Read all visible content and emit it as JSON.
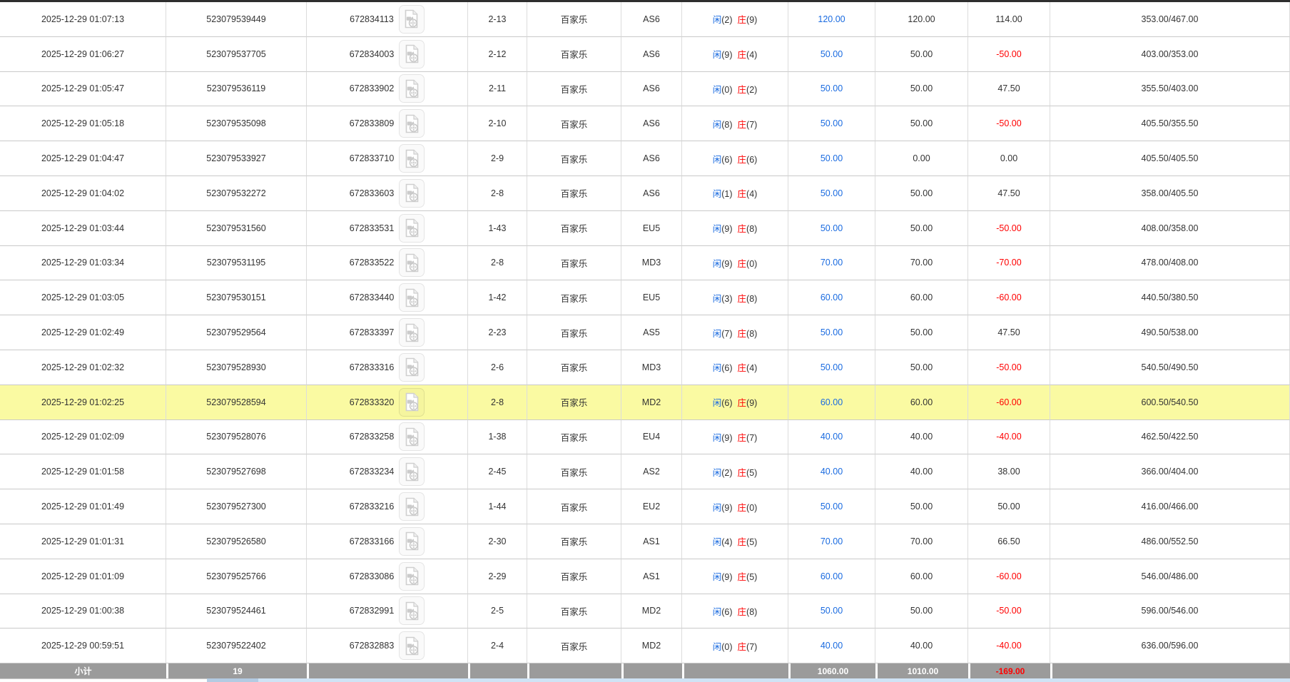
{
  "colors": {
    "accent_blue": "#1a6be0",
    "accent_red": "#ff0000",
    "highlight_yellow": "#fafaa2",
    "footer_grey": "#9b9b9b"
  },
  "labels": {
    "player": "闲",
    "banker": "庄"
  },
  "icons": {
    "replay": "video-replay-icon"
  },
  "rows": [
    {
      "time": "2025-12-29 01:07:13",
      "bet_no": "523079539449",
      "round_no": "672834113",
      "shoe_round": "2-13",
      "game": "百家乐",
      "table_code": "AS6",
      "player_score": "2",
      "banker_score": "9",
      "bet_amount": "120.00",
      "valid_amount": "120.00",
      "win_loss": "114.00",
      "balance": "353.00/467.00",
      "highlighted": false
    },
    {
      "time": "2025-12-29 01:06:27",
      "bet_no": "523079537705",
      "round_no": "672834003",
      "shoe_round": "2-12",
      "game": "百家乐",
      "table_code": "AS6",
      "player_score": "9",
      "banker_score": "4",
      "bet_amount": "50.00",
      "valid_amount": "50.00",
      "win_loss": "-50.00",
      "balance": "403.00/353.00",
      "highlighted": false
    },
    {
      "time": "2025-12-29 01:05:47",
      "bet_no": "523079536119",
      "round_no": "672833902",
      "shoe_round": "2-11",
      "game": "百家乐",
      "table_code": "AS6",
      "player_score": "0",
      "banker_score": "2",
      "bet_amount": "50.00",
      "valid_amount": "50.00",
      "win_loss": "47.50",
      "balance": "355.50/403.00",
      "highlighted": false
    },
    {
      "time": "2025-12-29 01:05:18",
      "bet_no": "523079535098",
      "round_no": "672833809",
      "shoe_round": "2-10",
      "game": "百家乐",
      "table_code": "AS6",
      "player_score": "8",
      "banker_score": "7",
      "bet_amount": "50.00",
      "valid_amount": "50.00",
      "win_loss": "-50.00",
      "balance": "405.50/355.50",
      "highlighted": false
    },
    {
      "time": "2025-12-29 01:04:47",
      "bet_no": "523079533927",
      "round_no": "672833710",
      "shoe_round": "2-9",
      "game": "百家乐",
      "table_code": "AS6",
      "player_score": "6",
      "banker_score": "6",
      "bet_amount": "50.00",
      "valid_amount": "0.00",
      "win_loss": "0.00",
      "balance": "405.50/405.50",
      "highlighted": false
    },
    {
      "time": "2025-12-29 01:04:02",
      "bet_no": "523079532272",
      "round_no": "672833603",
      "shoe_round": "2-8",
      "game": "百家乐",
      "table_code": "AS6",
      "player_score": "1",
      "banker_score": "4",
      "bet_amount": "50.00",
      "valid_amount": "50.00",
      "win_loss": "47.50",
      "balance": "358.00/405.50",
      "highlighted": false
    },
    {
      "time": "2025-12-29 01:03:44",
      "bet_no": "523079531560",
      "round_no": "672833531",
      "shoe_round": "1-43",
      "game": "百家乐",
      "table_code": "EU5",
      "player_score": "9",
      "banker_score": "8",
      "bet_amount": "50.00",
      "valid_amount": "50.00",
      "win_loss": "-50.00",
      "balance": "408.00/358.00",
      "highlighted": false
    },
    {
      "time": "2025-12-29 01:03:34",
      "bet_no": "523079531195",
      "round_no": "672833522",
      "shoe_round": "2-8",
      "game": "百家乐",
      "table_code": "MD3",
      "player_score": "9",
      "banker_score": "0",
      "bet_amount": "70.00",
      "valid_amount": "70.00",
      "win_loss": "-70.00",
      "balance": "478.00/408.00",
      "highlighted": false
    },
    {
      "time": "2025-12-29 01:03:05",
      "bet_no": "523079530151",
      "round_no": "672833440",
      "shoe_round": "1-42",
      "game": "百家乐",
      "table_code": "EU5",
      "player_score": "3",
      "banker_score": "8",
      "bet_amount": "60.00",
      "valid_amount": "60.00",
      "win_loss": "-60.00",
      "balance": "440.50/380.50",
      "highlighted": false
    },
    {
      "time": "2025-12-29 01:02:49",
      "bet_no": "523079529564",
      "round_no": "672833397",
      "shoe_round": "2-23",
      "game": "百家乐",
      "table_code": "AS5",
      "player_score": "7",
      "banker_score": "8",
      "bet_amount": "50.00",
      "valid_amount": "50.00",
      "win_loss": "47.50",
      "balance": "490.50/538.00",
      "highlighted": false
    },
    {
      "time": "2025-12-29 01:02:32",
      "bet_no": "523079528930",
      "round_no": "672833316",
      "shoe_round": "2-6",
      "game": "百家乐",
      "table_code": "MD3",
      "player_score": "6",
      "banker_score": "4",
      "bet_amount": "50.00",
      "valid_amount": "50.00",
      "win_loss": "-50.00",
      "balance": "540.50/490.50",
      "highlighted": false
    },
    {
      "time": "2025-12-29 01:02:25",
      "bet_no": "523079528594",
      "round_no": "672833320",
      "shoe_round": "2-8",
      "game": "百家乐",
      "table_code": "MD2",
      "player_score": "6",
      "banker_score": "9",
      "bet_amount": "60.00",
      "valid_amount": "60.00",
      "win_loss": "-60.00",
      "balance": "600.50/540.50",
      "highlighted": true
    },
    {
      "time": "2025-12-29 01:02:09",
      "bet_no": "523079528076",
      "round_no": "672833258",
      "shoe_round": "1-38",
      "game": "百家乐",
      "table_code": "EU4",
      "player_score": "9",
      "banker_score": "7",
      "bet_amount": "40.00",
      "valid_amount": "40.00",
      "win_loss": "-40.00",
      "balance": "462.50/422.50",
      "highlighted": false
    },
    {
      "time": "2025-12-29 01:01:58",
      "bet_no": "523079527698",
      "round_no": "672833234",
      "shoe_round": "2-45",
      "game": "百家乐",
      "table_code": "AS2",
      "player_score": "2",
      "banker_score": "5",
      "bet_amount": "40.00",
      "valid_amount": "40.00",
      "win_loss": "38.00",
      "balance": "366.00/404.00",
      "highlighted": false
    },
    {
      "time": "2025-12-29 01:01:49",
      "bet_no": "523079527300",
      "round_no": "672833216",
      "shoe_round": "1-44",
      "game": "百家乐",
      "table_code": "EU2",
      "player_score": "9",
      "banker_score": "0",
      "bet_amount": "50.00",
      "valid_amount": "50.00",
      "win_loss": "50.00",
      "balance": "416.00/466.00",
      "highlighted": false
    },
    {
      "time": "2025-12-29 01:01:31",
      "bet_no": "523079526580",
      "round_no": "672833166",
      "shoe_round": "2-30",
      "game": "百家乐",
      "table_code": "AS1",
      "player_score": "4",
      "banker_score": "5",
      "bet_amount": "70.00",
      "valid_amount": "70.00",
      "win_loss": "66.50",
      "balance": "486.00/552.50",
      "highlighted": false
    },
    {
      "time": "2025-12-29 01:01:09",
      "bet_no": "523079525766",
      "round_no": "672833086",
      "shoe_round": "2-29",
      "game": "百家乐",
      "table_code": "AS1",
      "player_score": "9",
      "banker_score": "5",
      "bet_amount": "60.00",
      "valid_amount": "60.00",
      "win_loss": "-60.00",
      "balance": "546.00/486.00",
      "highlighted": false
    },
    {
      "time": "2025-12-29 01:00:38",
      "bet_no": "523079524461",
      "round_no": "672832991",
      "shoe_round": "2-5",
      "game": "百家乐",
      "table_code": "MD2",
      "player_score": "6",
      "banker_score": "8",
      "bet_amount": "50.00",
      "valid_amount": "50.00",
      "win_loss": "-50.00",
      "balance": "596.00/546.00",
      "highlighted": false
    },
    {
      "time": "2025-12-29 00:59:51",
      "bet_no": "523079522402",
      "round_no": "672832883",
      "shoe_round": "2-4",
      "game": "百家乐",
      "table_code": "MD2",
      "player_score": "0",
      "banker_score": "7",
      "bet_amount": "40.00",
      "valid_amount": "40.00",
      "win_loss": "-40.00",
      "balance": "636.00/596.00",
      "highlighted": false
    }
  ],
  "footer": {
    "label": "小计",
    "count": "19",
    "bet_total": "1060.00",
    "valid_total": "1010.00",
    "win_loss_total": "-169.00"
  }
}
